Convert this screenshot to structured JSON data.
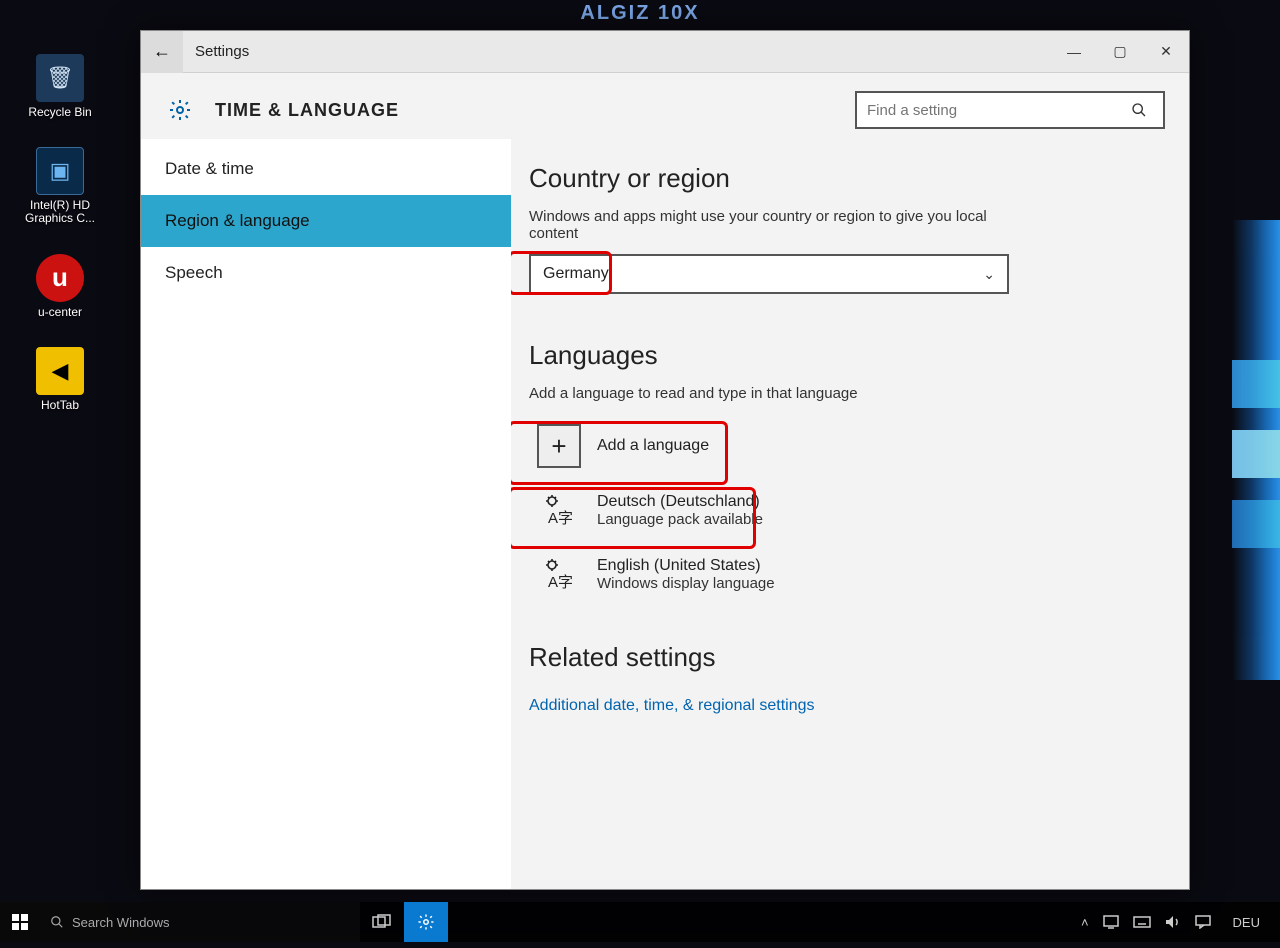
{
  "bezel": {
    "label": "ALGIZ 10X"
  },
  "desktop": {
    "icons": [
      {
        "label": "Recycle Bin"
      },
      {
        "label": "Intel(R) HD\nGraphics C..."
      },
      {
        "label": "u-center"
      },
      {
        "label": "HotTab"
      }
    ]
  },
  "window": {
    "titlebar": {
      "title": "Settings",
      "back": "←",
      "min": "—",
      "max": "▢",
      "close": "✕"
    },
    "section": "TIME & LANGUAGE",
    "search_placeholder": "Find a setting",
    "sidebar": {
      "items": [
        {
          "label": "Date & time",
          "active": false
        },
        {
          "label": "Region & language",
          "active": true
        },
        {
          "label": "Speech",
          "active": false
        }
      ]
    },
    "content": {
      "region_heading": "Country or region",
      "region_desc": "Windows and apps might use your country or region to give you local content",
      "region_selected": "Germany",
      "languages_heading": "Languages",
      "languages_desc": "Add a language to read and type in that language",
      "add_language_label": "Add a language",
      "installed_languages": [
        {
          "name": "Deutsch (Deutschland)",
          "status": "Language pack available"
        },
        {
          "name": "English (United States)",
          "status": "Windows display language"
        }
      ],
      "related_heading": "Related settings",
      "related_link": "Additional date, time, & regional settings"
    }
  },
  "taskbar": {
    "search_placeholder": "Search Windows",
    "language_indicator": "DEU"
  }
}
